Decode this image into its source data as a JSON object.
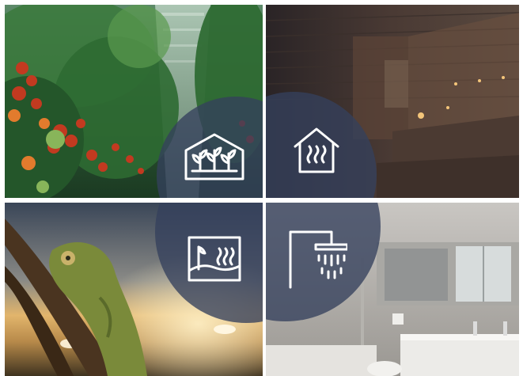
{
  "tiles": [
    {
      "id": "greenhouse",
      "icon": "greenhouse-icon"
    },
    {
      "id": "sauna",
      "icon": "sauna-heat-icon"
    },
    {
      "id": "terrarium",
      "icon": "terrarium-heat-icon"
    },
    {
      "id": "bathroom",
      "icon": "rain-shower-icon"
    }
  ],
  "colors": {
    "badge": "#34405C",
    "icon_stroke": "#FFFFFF",
    "page_background": "#FFFFFF"
  }
}
